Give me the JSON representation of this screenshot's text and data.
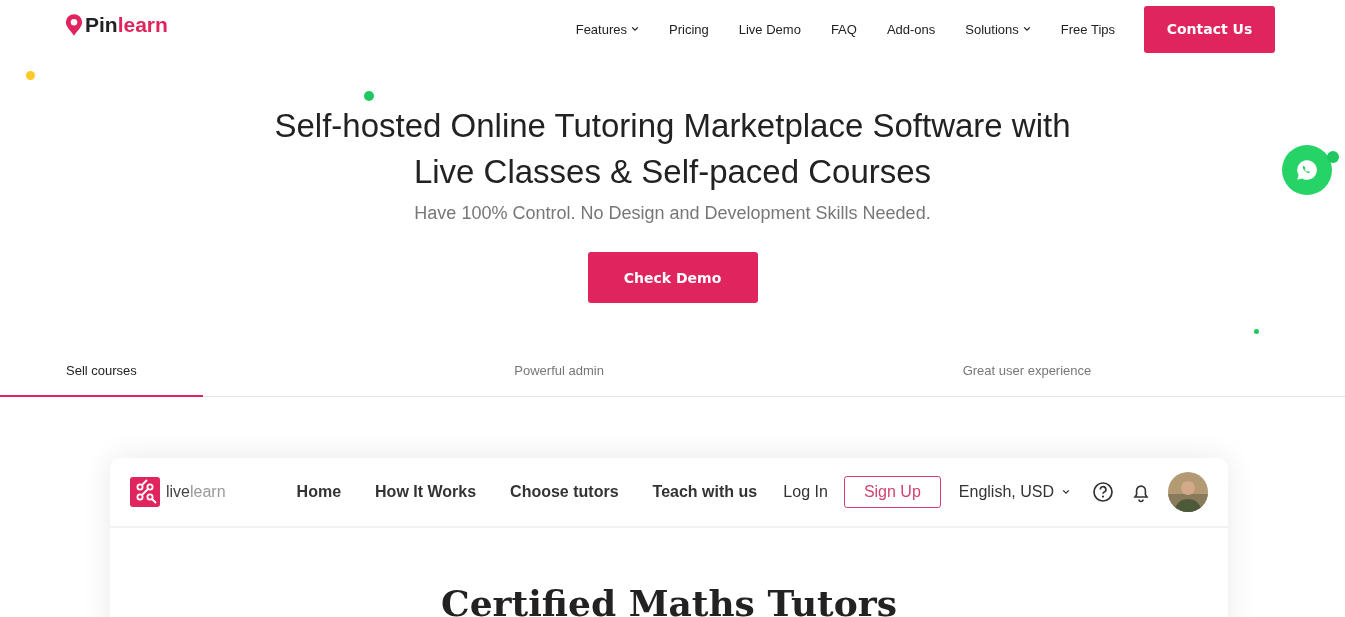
{
  "header": {
    "logo": {
      "prefix": "Pin",
      "suffix": "learn"
    },
    "nav": [
      {
        "label": "Features",
        "has_menu": true
      },
      {
        "label": "Pricing",
        "has_menu": false
      },
      {
        "label": "Live Demo",
        "has_menu": false
      },
      {
        "label": "FAQ",
        "has_menu": false
      },
      {
        "label": "Add-ons",
        "has_menu": false
      },
      {
        "label": "Solutions",
        "has_menu": true
      },
      {
        "label": "Free Tips",
        "has_menu": false
      }
    ],
    "cta": "Contact Us"
  },
  "hero": {
    "title": "Self-hosted Online Tutoring Marketplace Software with Live Classes & Self-paced Courses",
    "subtitle": "Have 100% Control. No Design and Development Skills Needed.",
    "button": "Check Demo"
  },
  "tabs": [
    {
      "label": "Sell courses",
      "selected": true
    },
    {
      "label": "Powerful admin",
      "selected": false
    },
    {
      "label": "Great user experience",
      "selected": false
    }
  ],
  "preview": {
    "logo": {
      "prefix": "live",
      "suffix": "learn"
    },
    "nav": [
      "Home",
      "How It Works",
      "Choose tutors",
      "Teach with us"
    ],
    "login": "Log In",
    "signup": "Sign Up",
    "language": "English, USD",
    "heading": "Certified Maths Tutors"
  }
}
